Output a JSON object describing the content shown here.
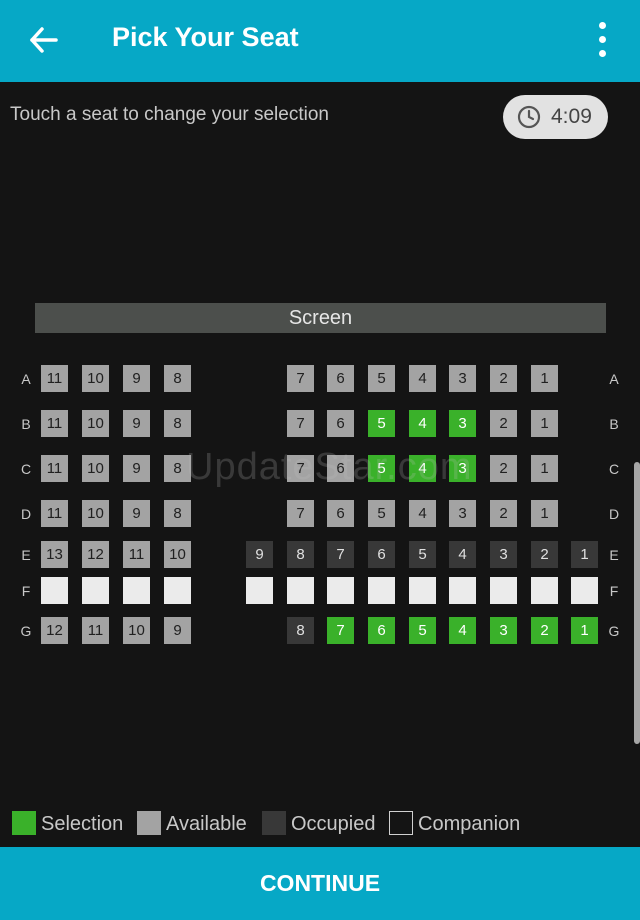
{
  "header": {
    "title": "Pick Your Seat",
    "back_icon": "arrow-left-icon",
    "menu_icon": "more-vert-icon"
  },
  "hint": "Touch a seat to change your selection",
  "timer": {
    "icon": "clock-icon",
    "value": "4:09"
  },
  "screen_label": "Screen",
  "watermark": "UpdateStar.com",
  "colors": {
    "accent": "#06a8c6",
    "selection": "#3ab12a",
    "available": "#a3a3a3",
    "occupied": "#383838",
    "companion": "#ebebeb"
  },
  "rows": [
    {
      "label": "A",
      "left": [
        {
          "n": "11",
          "s": "available"
        },
        {
          "n": "10",
          "s": "available"
        },
        {
          "n": "9",
          "s": "available"
        },
        {
          "n": "8",
          "s": "available"
        }
      ],
      "right": [
        null,
        {
          "n": "7",
          "s": "available"
        },
        {
          "n": "6",
          "s": "available"
        },
        {
          "n": "5",
          "s": "available"
        },
        {
          "n": "4",
          "s": "available"
        },
        {
          "n": "3",
          "s": "available"
        },
        {
          "n": "2",
          "s": "available"
        },
        {
          "n": "1",
          "s": "available"
        },
        null,
        null
      ]
    },
    {
      "label": "B",
      "left": [
        {
          "n": "11",
          "s": "available"
        },
        {
          "n": "10",
          "s": "available"
        },
        {
          "n": "9",
          "s": "available"
        },
        {
          "n": "8",
          "s": "available"
        }
      ],
      "right": [
        null,
        {
          "n": "7",
          "s": "available"
        },
        {
          "n": "6",
          "s": "available"
        },
        {
          "n": "5",
          "s": "selection"
        },
        {
          "n": "4",
          "s": "selection"
        },
        {
          "n": "3",
          "s": "selection"
        },
        {
          "n": "2",
          "s": "available"
        },
        {
          "n": "1",
          "s": "available"
        },
        null,
        null
      ]
    },
    {
      "label": "C",
      "left": [
        {
          "n": "11",
          "s": "available"
        },
        {
          "n": "10",
          "s": "available"
        },
        {
          "n": "9",
          "s": "available"
        },
        {
          "n": "8",
          "s": "available"
        }
      ],
      "right": [
        null,
        {
          "n": "7",
          "s": "available"
        },
        {
          "n": "6",
          "s": "available"
        },
        {
          "n": "5",
          "s": "selection"
        },
        {
          "n": "4",
          "s": "selection"
        },
        {
          "n": "3",
          "s": "selection"
        },
        {
          "n": "2",
          "s": "available"
        },
        {
          "n": "1",
          "s": "available"
        },
        null,
        null
      ]
    },
    {
      "label": "D",
      "left": [
        {
          "n": "11",
          "s": "available"
        },
        {
          "n": "10",
          "s": "available"
        },
        {
          "n": "9",
          "s": "available"
        },
        {
          "n": "8",
          "s": "available"
        }
      ],
      "right": [
        null,
        {
          "n": "7",
          "s": "available"
        },
        {
          "n": "6",
          "s": "available"
        },
        {
          "n": "5",
          "s": "available"
        },
        {
          "n": "4",
          "s": "available"
        },
        {
          "n": "3",
          "s": "available"
        },
        {
          "n": "2",
          "s": "available"
        },
        {
          "n": "1",
          "s": "available"
        },
        null,
        null
      ]
    },
    {
      "label": "E",
      "left": [
        {
          "n": "13",
          "s": "available"
        },
        {
          "n": "12",
          "s": "available"
        },
        {
          "n": "11",
          "s": "available"
        },
        {
          "n": "10",
          "s": "available"
        }
      ],
      "right": [
        {
          "n": "9",
          "s": "occupied"
        },
        {
          "n": "8",
          "s": "occupied"
        },
        {
          "n": "7",
          "s": "occupied"
        },
        {
          "n": "6",
          "s": "occupied"
        },
        {
          "n": "5",
          "s": "occupied"
        },
        {
          "n": "4",
          "s": "occupied"
        },
        {
          "n": "3",
          "s": "occupied"
        },
        {
          "n": "2",
          "s": "occupied"
        },
        {
          "n": "1",
          "s": "occupied"
        }
      ]
    },
    {
      "label": "F",
      "left": [
        {
          "n": "",
          "s": "companion"
        },
        {
          "n": "",
          "s": "companion"
        },
        {
          "n": "",
          "s": "companion"
        },
        {
          "n": "",
          "s": "companion"
        }
      ],
      "right": [
        {
          "n": "",
          "s": "companion"
        },
        {
          "n": "",
          "s": "companion"
        },
        {
          "n": "",
          "s": "companion"
        },
        {
          "n": "",
          "s": "companion"
        },
        {
          "n": "",
          "s": "companion"
        },
        {
          "n": "",
          "s": "companion"
        },
        {
          "n": "",
          "s": "companion"
        },
        {
          "n": "",
          "s": "companion"
        },
        {
          "n": "",
          "s": "companion"
        }
      ]
    },
    {
      "label": "G",
      "left": [
        {
          "n": "12",
          "s": "available"
        },
        {
          "n": "11",
          "s": "available"
        },
        {
          "n": "10",
          "s": "available"
        },
        {
          "n": "9",
          "s": "available"
        }
      ],
      "right": [
        null,
        {
          "n": "8",
          "s": "occupied"
        },
        {
          "n": "7",
          "s": "selection"
        },
        {
          "n": "6",
          "s": "selection"
        },
        {
          "n": "5",
          "s": "selection"
        },
        {
          "n": "4",
          "s": "selection"
        },
        {
          "n": "3",
          "s": "selection"
        },
        {
          "n": "2",
          "s": "selection"
        },
        {
          "n": "1",
          "s": "selection"
        }
      ]
    }
  ],
  "legend": [
    {
      "label": "Selection",
      "kind": "selection"
    },
    {
      "label": "Available",
      "kind": "available"
    },
    {
      "label": "Occupied",
      "kind": "occupied"
    },
    {
      "label": "Companion",
      "kind": "companion"
    }
  ],
  "continue_label": "CONTINUE"
}
